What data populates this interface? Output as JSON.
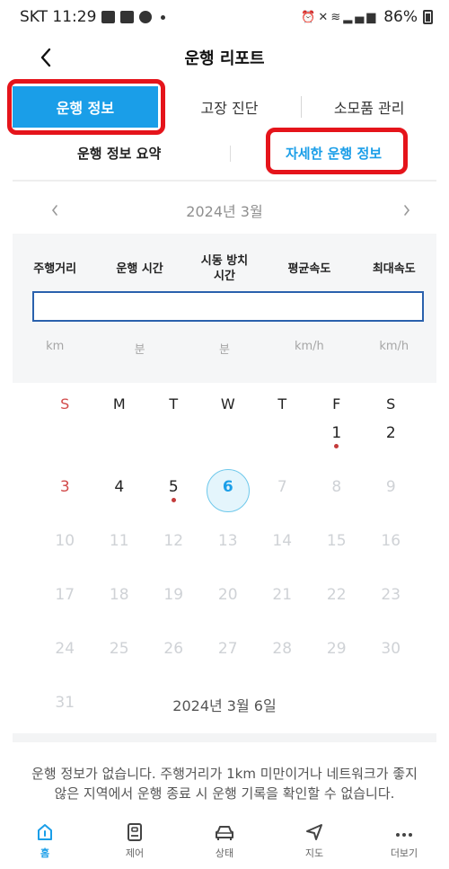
{
  "status_bar": {
    "carrier_time": "SKT 11:29",
    "battery": "86%"
  },
  "header": {
    "title": "운행 리포트"
  },
  "tabs": [
    {
      "label": "운행 정보"
    },
    {
      "label": "고장 진단"
    },
    {
      "label": "소모품 관리"
    }
  ],
  "subtabs": [
    {
      "label": "운행 정보 요약"
    },
    {
      "label": "자세한 운행 정보"
    }
  ],
  "month_nav": {
    "label": "2024년 3월",
    "prev": "‹",
    "next": "›"
  },
  "stats": {
    "headers": [
      "주행거리",
      "운행 시간",
      "시동 방치\n시간",
      "평균속도",
      "최대속도"
    ],
    "units": [
      "km",
      "분",
      "분",
      "km/h",
      "km/h"
    ]
  },
  "calendar": {
    "weekdays": [
      "S",
      "M",
      "T",
      "W",
      "T",
      "F",
      "S"
    ],
    "weeks": [
      [
        null,
        null,
        null,
        null,
        null,
        "1",
        "2"
      ],
      [
        "3",
        "4",
        "5",
        "6",
        "7",
        "8",
        "9"
      ],
      [
        "10",
        "11",
        "12",
        "13",
        "14",
        "15",
        "16"
      ],
      [
        "17",
        "18",
        "19",
        "20",
        "21",
        "22",
        "23"
      ],
      [
        "24",
        "25",
        "26",
        "27",
        "28",
        "29",
        "30"
      ],
      [
        "31",
        null,
        null,
        null,
        null,
        null,
        null
      ]
    ],
    "today": "6",
    "record_days": [
      "1",
      "5"
    ]
  },
  "selected_date": "2024년 3월 6일",
  "no_data_message": "운행 정보가 없습니다. 주행거리가 1km 미만이거나 네트워크가 좋지 않은 지역에서 운행 종료 시 운행 기록을 확인할 수 없습니다.",
  "bottom_nav": [
    {
      "label": "홈",
      "icon": "home-icon"
    },
    {
      "label": "제어",
      "icon": "remote-icon"
    },
    {
      "label": "상태",
      "icon": "car-icon"
    },
    {
      "label": "지도",
      "icon": "navigation-arrow-icon"
    },
    {
      "label": "더보기",
      "icon": "more-dots-icon"
    }
  ],
  "colors": {
    "accent": "#1a9ee8",
    "highlight": "#e5141b",
    "sunday": "#d24b4b",
    "input_border": "#2a61ad"
  }
}
